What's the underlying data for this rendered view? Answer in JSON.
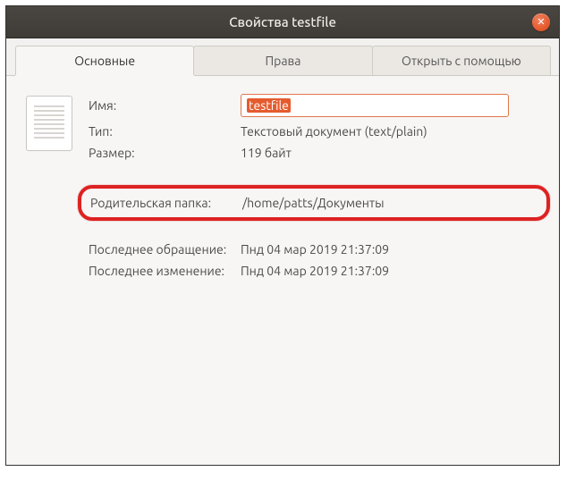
{
  "window": {
    "title": "Свойства testfile"
  },
  "tabs": {
    "basic": "Основные",
    "permissions": "Права",
    "openwith": "Открыть с помощью"
  },
  "labels": {
    "name": "Имя:",
    "type": "Тип:",
    "size": "Размер:",
    "parent": "Родительская папка:",
    "accessed": "Последнее обращение:",
    "modified": "Последнее изменение:"
  },
  "values": {
    "name": "testfile",
    "type": "Текстовый документ (text/plain)",
    "size": "119 байт",
    "parent": "/home/patts/Документы",
    "accessed": "Пнд 04 мар 2019 21:37:09",
    "modified": "Пнд 04 мар 2019 21:37:09"
  }
}
